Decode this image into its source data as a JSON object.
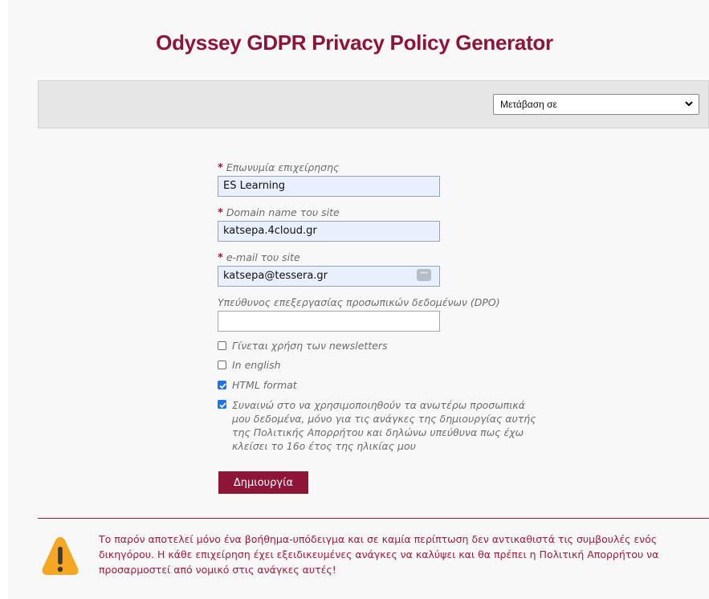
{
  "page_title": "Odyssey GDPR Privacy Policy Generator",
  "nav": {
    "jump_select_value": "Μετάβαση σε"
  },
  "form": {
    "company": {
      "label": "Επωνυμία επιχείρησης",
      "required": true,
      "value": "ES Learning"
    },
    "domain": {
      "label": "Domain name του site",
      "required": true,
      "value": "katsepa.4cloud.gr"
    },
    "email": {
      "label": "e-mail του site",
      "required": true,
      "value": "katsepa@tessera.gr",
      "autofill_icon": "dots-icon"
    },
    "dpo": {
      "label": "Υπεύθυνος επεξεργασίας προσωπικών δεδομένων (DPO)",
      "required": false,
      "value": ""
    },
    "checkboxes": [
      {
        "label": "Γίνεται χρήση των newsletters",
        "checked": false
      },
      {
        "label": "In english",
        "checked": false
      },
      {
        "label": "HTML format",
        "checked": true
      },
      {
        "label": "Συναινώ στο να χρησιμοποιηθούν τα ανωτέρω προσωπικά μου δεδομένα, μόνο για τις ανάγκες της δημιουργίας αυτής της Πολιτικής Απορρήτου και δηλώνω υπεύθυνα πως έχω κλείσει το 16ο έτος της ηλικίας μου",
        "checked": true
      }
    ],
    "submit_label": "Δημιουργία",
    "required_marker": "*"
  },
  "notice": {
    "icon": "warning-icon",
    "text": "Το παρόν αποτελεί μόνο ένα βοήθημα-υπόδειγμα και σε καμία περίπτωση δεν αντικαθιστά τις συμβουλές ενός δικηγόρου. Η κάθε επιχείρηση έχει εξειδικευμένες ανάγκες να καλύψει και θα πρέπει η Πολιτική Απορρήτου να προσαρμοστεί από νομικό στις ανάγκες αυτές!"
  },
  "colors": {
    "brand": "#8f1538",
    "accent_red": "#a8193c",
    "checkbox_blue": "#1a73e8",
    "warning_orange": "#f5a623"
  }
}
